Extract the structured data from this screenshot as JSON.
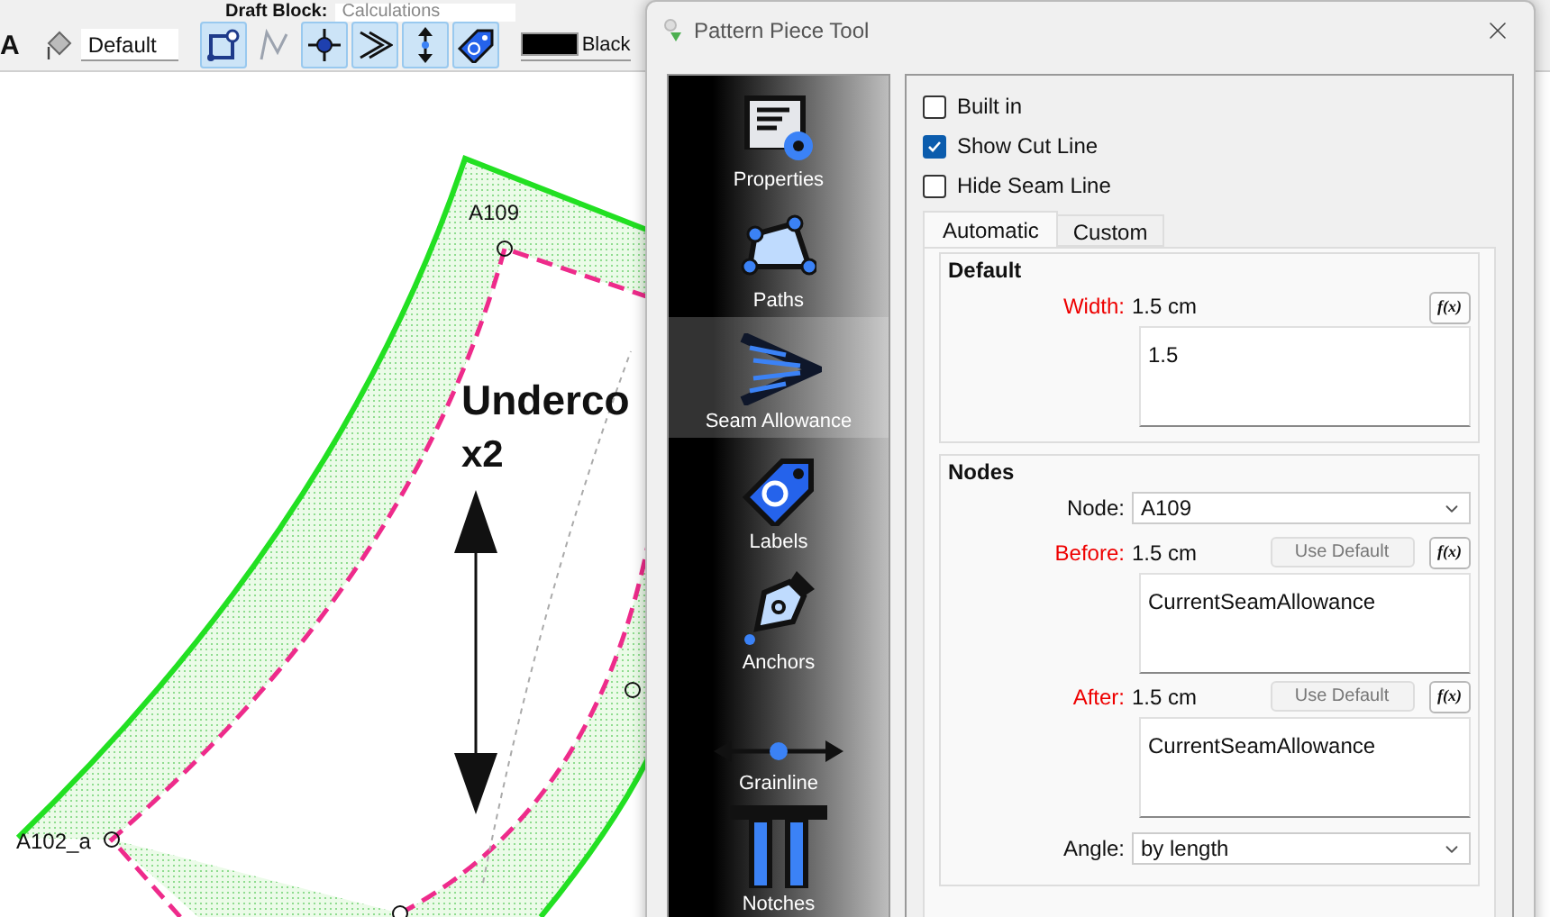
{
  "app_toolbar": {
    "draft_block_label": "Draft Block:",
    "draft_block_value": "Calculations",
    "text_size_glyph": "A",
    "line_type": "Default",
    "tools": [
      {
        "kind": "square-node",
        "selected": true
      },
      {
        "kind": "curve",
        "selected": false
      },
      {
        "kind": "crosshair",
        "selected": true
      },
      {
        "kind": "chevrons",
        "selected": true
      },
      {
        "kind": "vertical-arrow",
        "selected": true
      },
      {
        "kind": "tag",
        "selected": true
      }
    ],
    "line_color": "Black"
  },
  "canvas": {
    "point_labels": [
      "A109",
      "A102_a"
    ],
    "piece_name": "Underco",
    "piece_quantity": "x2"
  },
  "dialog": {
    "title": "Pattern Piece Tool",
    "sidebar": [
      {
        "kind": "properties",
        "label": "Properties",
        "selected": false
      },
      {
        "kind": "paths",
        "label": "Paths",
        "selected": false
      },
      {
        "kind": "seam",
        "label": "Seam Allowance",
        "selected": true
      },
      {
        "kind": "labels",
        "label": "Labels",
        "selected": false
      },
      {
        "kind": "anchors",
        "label": "Anchors",
        "selected": false
      },
      {
        "kind": "grainline",
        "label": "Grainline",
        "selected": false
      },
      {
        "kind": "notches",
        "label": "Notches",
        "selected": false
      }
    ],
    "checkboxes": [
      {
        "label": "Built in",
        "checked": false
      },
      {
        "label": "Show Cut Line",
        "checked": true
      },
      {
        "label": "Hide Seam Line",
        "checked": false
      }
    ],
    "tabs": [
      {
        "label": "Automatic",
        "selected": true
      },
      {
        "label": "Custom",
        "selected": false
      }
    ],
    "default_group": {
      "title": "Default",
      "width_label": "Width:",
      "width_value": "1.5 cm",
      "formula_button": "f(x)",
      "formula": "1.5"
    },
    "nodes_group": {
      "title": "Nodes",
      "node_label": "Node:",
      "node_value": "A109",
      "before_label": "Before:",
      "before_value": "1.5 cm",
      "before_default_button": "Use Default",
      "before_formula_button": "f(x)",
      "before_formula": "CurrentSeamAllowance",
      "after_label": "After:",
      "after_value": "1.5 cm",
      "after_default_button": "Use Default",
      "after_formula_button": "f(x)",
      "after_formula": "CurrentSeamAllowance",
      "angle_label": "Angle:",
      "angle_value": "by length"
    }
  }
}
